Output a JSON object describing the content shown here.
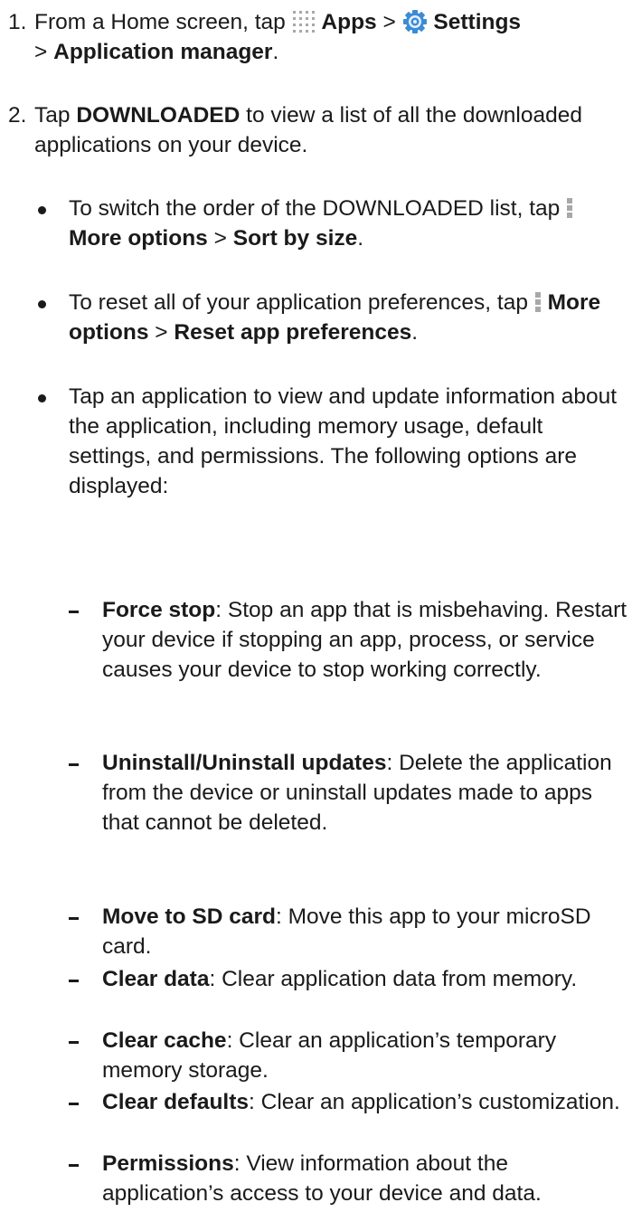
{
  "steps": [
    {
      "number": "1.",
      "from": "From a Home screen, tap",
      "apps": "Apps",
      "sep1": ">",
      "settings": "Settings",
      "sep2": ">",
      "app_manager": "Application manager",
      "end": "."
    },
    {
      "number": "2.",
      "tap": "Tap",
      "downloaded": "DOWNLOADED",
      "rest": "to view a list of all the downloaded applications on your device."
    }
  ],
  "bullets": [
    {
      "pre": "To switch the order of the DOWNLOADED list, tap",
      "menu": "More options",
      "sep": ">",
      "action": "Sort by size",
      "end": "."
    },
    {
      "pre": "To reset all of your application preferences, tap",
      "menu": "More options",
      "sep": ">",
      "action": "Reset app preferences",
      "end": "."
    },
    {
      "text": "Tap an application to view and update information about the application, including memory usage, default settings, and permissions. The following options are displayed:"
    }
  ],
  "options": [
    {
      "term": "Force stop",
      "desc": ": Stop an app that is misbehaving. Restart your device if stopping an app, process, or service causes your device to stop working correctly."
    },
    {
      "term": "Uninstall/Uninstall updates",
      "desc": ": Delete the application from the device or uninstall updates made to apps that cannot be deleted."
    },
    {
      "term": "Move to SD card",
      "desc": ": Move this app to your microSD card."
    },
    {
      "term": "Clear data",
      "desc": ": Clear application data from memory."
    },
    {
      "term": "Clear cache",
      "desc": ": Clear an application’s temporary memory storage."
    },
    {
      "term": "Clear defaults",
      "desc": ": Clear an application’s customization."
    },
    {
      "term": "Permissions",
      "desc": ": View information about the application’s access to your device and data."
    }
  ],
  "icons": {
    "apps": "apps-grid-icon",
    "settings": "settings-gear-icon",
    "more_options": "more-options-icon"
  },
  "colors": {
    "text": "#1a1a1a",
    "icon_gray": "#a8a8a8",
    "gear_blue": "#3c8bd6"
  }
}
